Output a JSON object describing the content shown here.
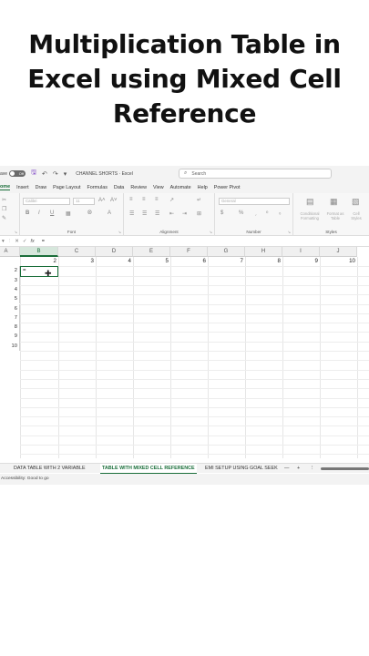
{
  "caption": {
    "line1": "Multiplication Table in",
    "line2": "Excel using Mixed Cell",
    "line3": "Reference"
  },
  "titlebar": {
    "autosave_label": "ave",
    "toggle_label": "Off",
    "doc_title": "CHANNEL SHORTS  ·  Excel",
    "search_placeholder": "Search"
  },
  "tabs": [
    "ome",
    "Insert",
    "Draw",
    "Page Layout",
    "Formulas",
    "Data",
    "Review",
    "View",
    "Automate",
    "Help",
    "Power Pivot"
  ],
  "ribbon": {
    "font_name": "Calibri",
    "font_size": "11",
    "font_label": "Font",
    "alignment_label": "Alignment",
    "number_label": "Number",
    "number_format": "General",
    "styles_label": "Styles",
    "conditional": "Conditional Formatting",
    "format_table": "Format as Table",
    "cell_styles": "Cell Styles"
  },
  "formula_bar": {
    "fx": "fx",
    "value": "="
  },
  "grid": {
    "columns": [
      "A",
      "B",
      "C",
      "D",
      "E",
      "F",
      "G",
      "H",
      "I",
      "J"
    ],
    "header_values": [
      "2",
      "3",
      "4",
      "5",
      "6",
      "7",
      "8",
      "9",
      "10"
    ],
    "row_values": [
      "2",
      "3",
      "4",
      "5",
      "6",
      "7",
      "8",
      "9",
      "10"
    ],
    "active_cell_text": "="
  },
  "sheets": [
    "DATA TABLE WITH 2 VARIABLE",
    "TABLE WITH MIXED CELL REFERENCE",
    "EMI SETUP USING GOAL SEEK",
    "+",
    "⋮"
  ],
  "status": {
    "text": "Accessibility: Good to go"
  },
  "colors": {
    "accent": "#1a6e3a",
    "save_icon": "#7a3fc4"
  }
}
